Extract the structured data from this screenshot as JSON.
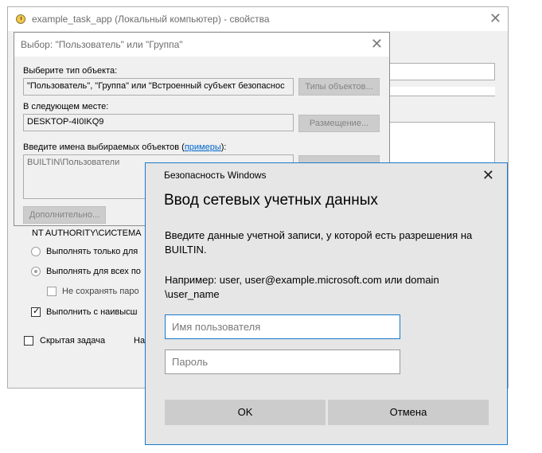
{
  "properties_window": {
    "title": "example_task_app (Локальный компьютер) - свойства",
    "close_glyph": "✕",
    "account_value": "NT AUTHORITY\\СИСТЕМА",
    "options": {
      "run_logged_on": "Выполнять только для",
      "run_all": "Выполнять для всех по",
      "no_save_password": "Не сохранять паро",
      "highest_privileges": "Выполнить с наивысш",
      "hidden_task": "Скрытая задача",
      "configure_for": "На"
    }
  },
  "select_dialog": {
    "title": "Выбор: \"Пользователь\" или \"Группа\"",
    "close_glyph": "✕",
    "object_type_label": "Выберите тип объекта:",
    "object_type_value": "\"Пользователь\", \"Группа\" или \"Встроенный субъект безопаснос",
    "object_types_button": "Типы объектов...",
    "location_label": "В следующем месте:",
    "location_value": "DESKTOP-4I0IKQ9",
    "location_button": "Размещение...",
    "names_label": "Введите имена выбираемых объектов (",
    "examples_link": "примеры",
    "names_label_end": "):",
    "names_value": "BUILTIN\\Пользователи",
    "advanced_button": "Дополнительно..."
  },
  "credential_dialog": {
    "caption": "Безопасность Windows",
    "close_glyph": "✕",
    "heading": "Ввод сетевых учетных данных",
    "instruction": "Введите данные учетной записи, у которой есть разрешения на BUILTIN.",
    "example": "Например: user, user@example.microsoft.com  или  domain \\user_name",
    "username_placeholder": "Имя пользователя",
    "password_placeholder": "Пароль",
    "ok_button": "OK",
    "cancel_button": "Отмена"
  },
  "colors": {
    "accent_border": "#1979ca",
    "link": "#0066cc",
    "dialog_bg": "#e6e6e6"
  }
}
